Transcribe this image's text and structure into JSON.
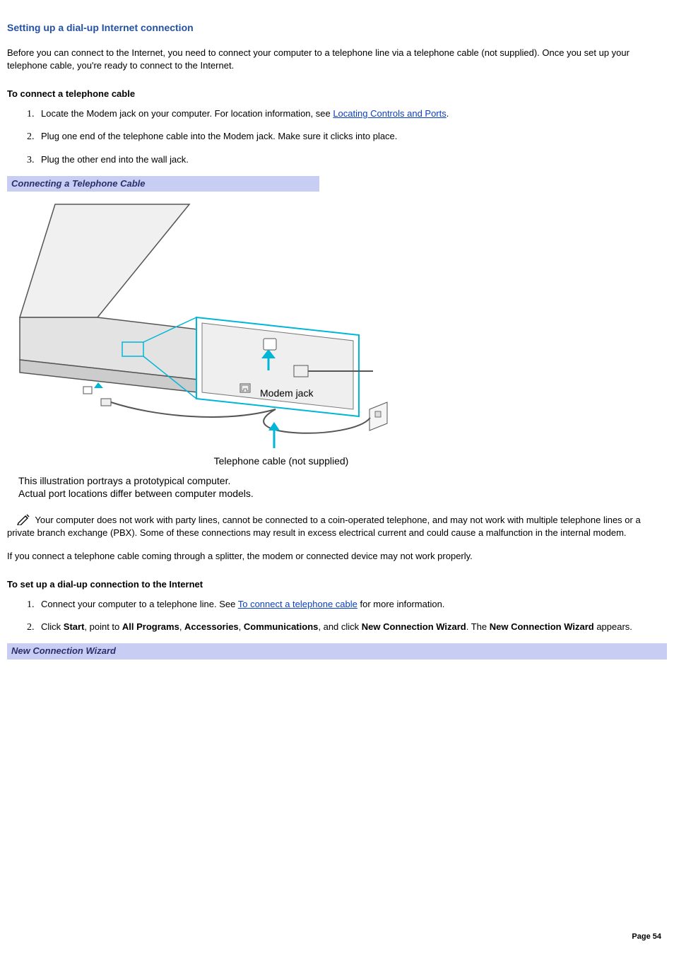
{
  "title": "Setting up a dial-up Internet connection",
  "intro": "Before you can connect to the Internet, you need to connect your computer to a telephone line via a telephone cable (not supplied). Once you set up your telephone cable, you're ready to connect to the Internet.",
  "subhead1": "To connect a telephone cable",
  "steps1": {
    "s1_a": "Locate the Modem jack on your computer. For location information, see ",
    "s1_link": "Locating Controls and Ports",
    "s1_b": ".",
    "s2": "Plug one end of the telephone cable into the Modem jack. Make sure it clicks into place.",
    "s3": "Plug the other end into the wall jack."
  },
  "band1": "Connecting a Telephone Cable",
  "diagram": {
    "modem_label": "Modem jack",
    "cable_label": "Telephone cable (not supplied)",
    "note_l1": "This illustration portrays a prototypical computer.",
    "note_l2": "Actual port locations differ between computer models."
  },
  "note1": "Your computer does not work with party lines, cannot be connected to a coin-operated telephone, and may not work with multiple telephone lines or a private branch exchange (PBX). Some of these connections may result in excess electrical current and could cause a malfunction in the internal modem.",
  "splitter_note": "If you connect a telephone cable coming through a splitter, the modem or connected device may not work properly.",
  "subhead2": "To set up a dial-up connection to the Internet",
  "steps2": {
    "s1_a": "Connect your computer to a telephone line. See ",
    "s1_link": "To connect a telephone cable",
    "s1_b": " for more information.",
    "s2": {
      "a": "Click ",
      "start": "Start",
      "b": ", point to ",
      "allprograms": "All Programs",
      "c": ", ",
      "accessories": "Accessories",
      "d": ", ",
      "communications": "Communications",
      "e": ", and click ",
      "wizard": "New Connection Wizard",
      "f": ". The ",
      "wizard2": "New Connection Wizard",
      "g": " appears."
    }
  },
  "band2": "New Connection Wizard",
  "page_number": "Page 54"
}
